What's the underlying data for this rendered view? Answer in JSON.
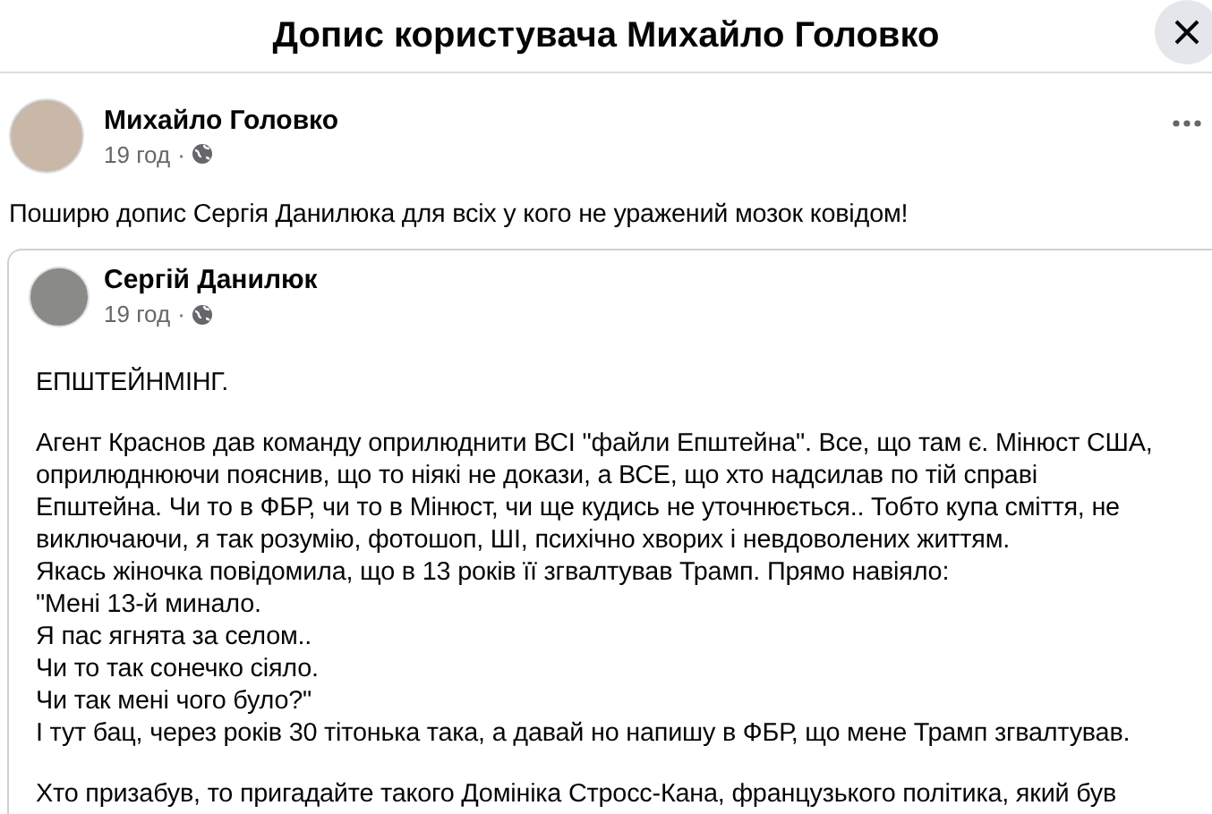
{
  "dialog": {
    "title": "Допис користувача Михайло Головко"
  },
  "post": {
    "author": "Михайло Головко",
    "time": "19 год",
    "separator": "·",
    "text": "Поширю допис Сергія Данилюка для всіх у кого не уражений мозок ковідом!"
  },
  "shared_post": {
    "author": "Сергій Данилюк",
    "time": "19 год",
    "separator": "·",
    "paragraphs": [
      [
        "ЕПШТЕЙНМІНГ."
      ],
      [
        "Агент Краснов дав команду оприлюднити ВСІ \"файли Епштейна\". Все, що там є. Мінюст США,",
        "оприлюднюючи пояснив, що то ніякі не докази, а ВСЕ, що хто надсилав по тій справі",
        "Епштейна.  Чи то в ФБР, чи то в Мінюст, чи ще кудись не уточнюється.. Тобто купа сміття, не",
        "виключаючи, я так розумію, фотошоп, ШІ, психічно хворих і невдоволених життям.",
        "Якась жіночка повідомила, що в 13 років її згвалтував Трамп. Прямо навіяло:",
        "\"Мені 13-й минало.",
        "Я пас ягнята за селом..",
        "Чи то так сонечко сіяло.",
        "Чи так мені чого було?\"",
        "І тут бац, через років 30 тітонька така, а давай но напишу в ФБР, що мене Трамп згвалтував."
      ],
      [
        "Хто призабув, то пригадайте такого Домініка Стросс-Кана, французького політика, який був"
      ]
    ]
  }
}
